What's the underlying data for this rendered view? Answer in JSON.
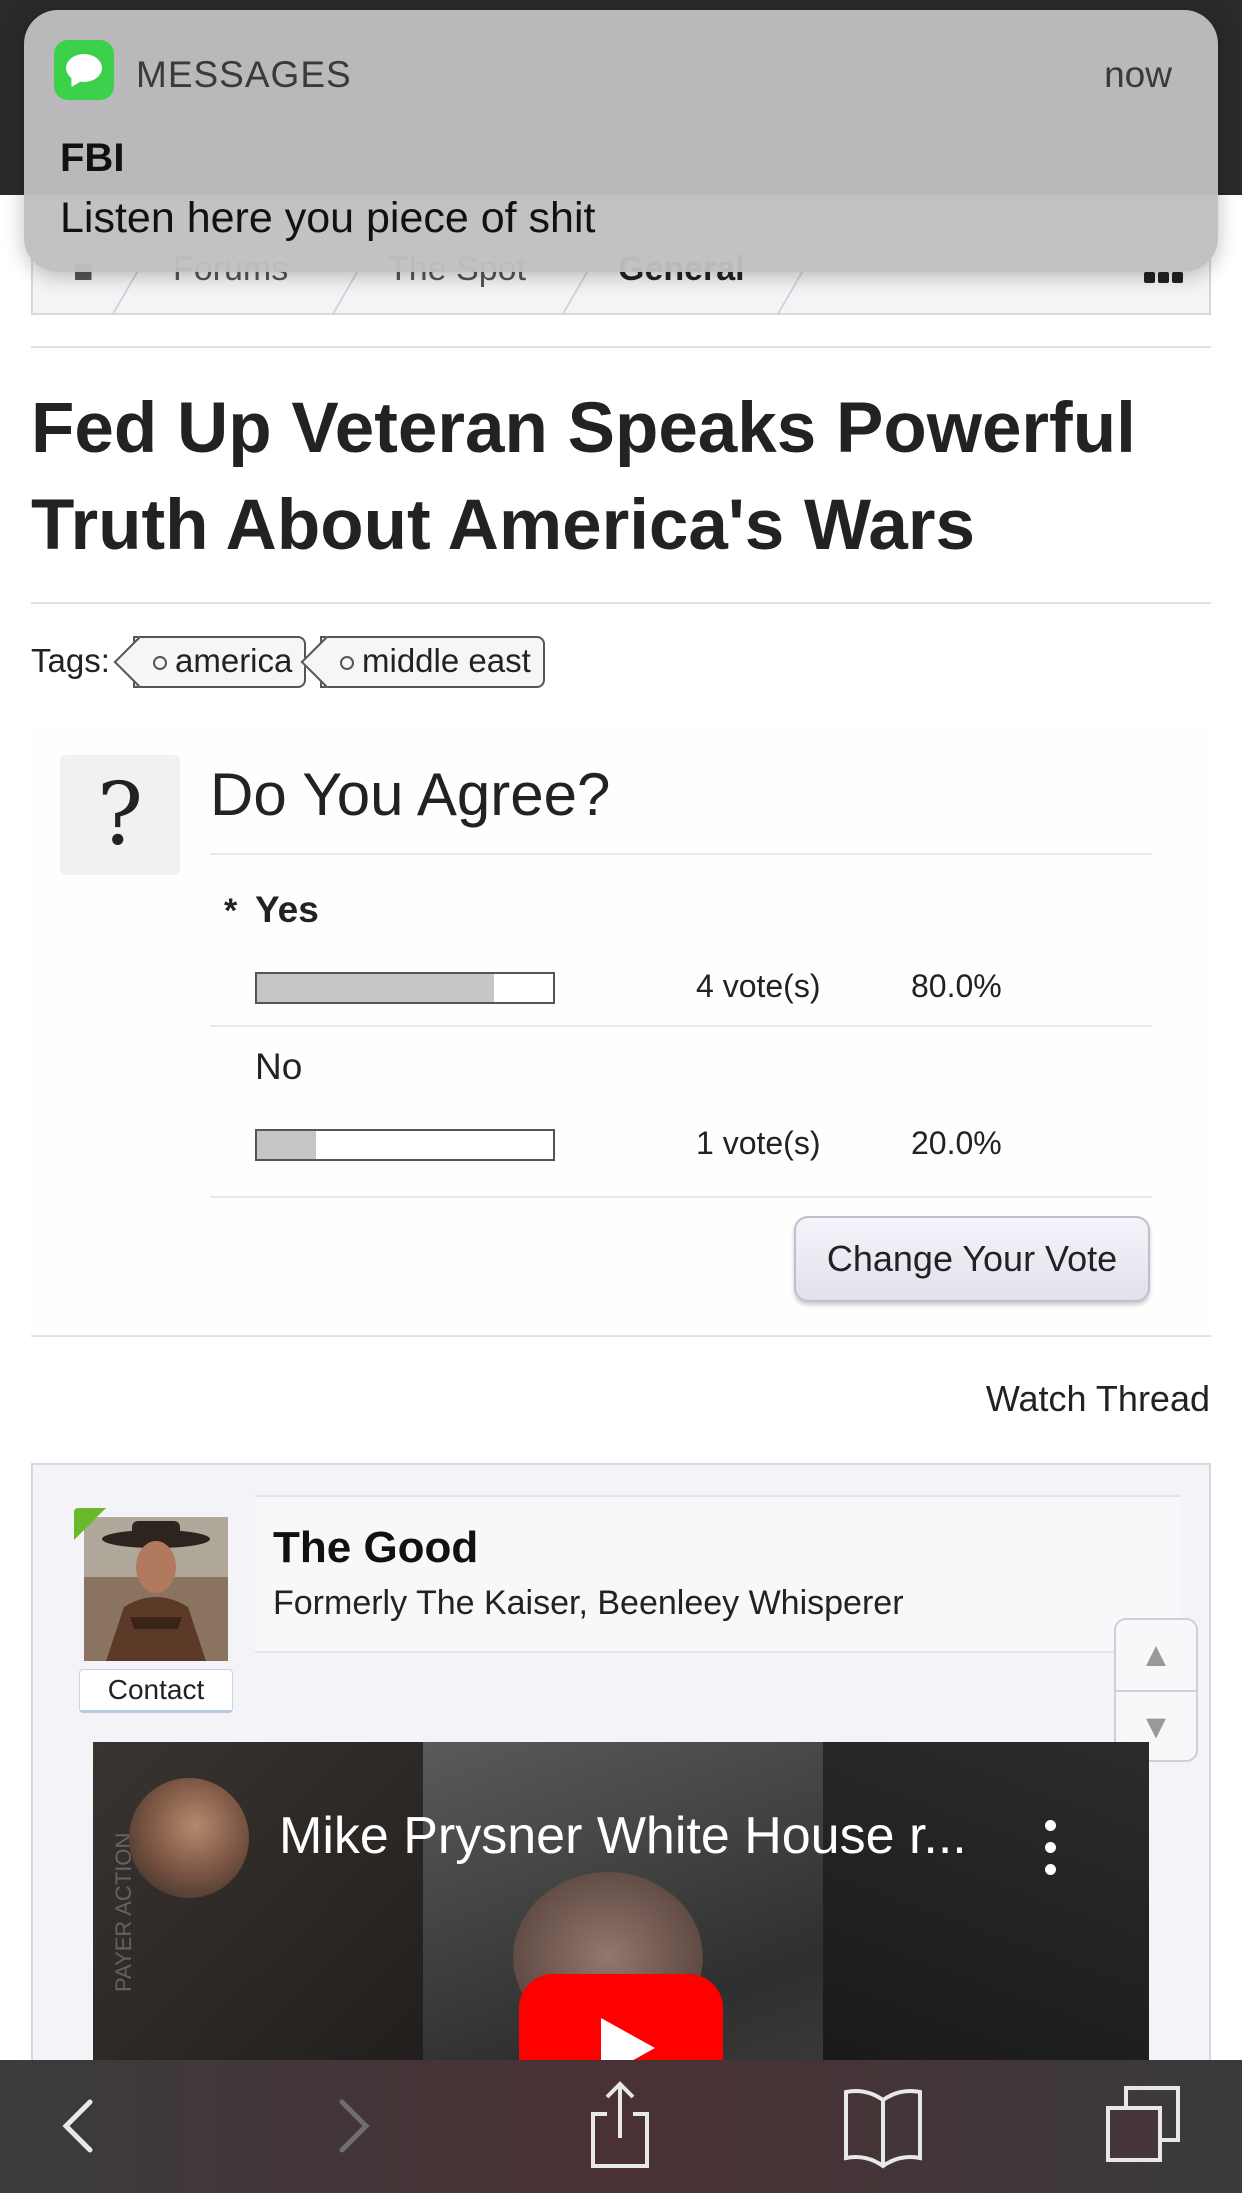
{
  "notification": {
    "app": "MESSAGES",
    "time": "now",
    "sender": "FBI",
    "message": "Listen here you piece of shit"
  },
  "breadcrumb": {
    "items": [
      "Forums",
      "The Spot",
      "General"
    ]
  },
  "thread": {
    "title": "Fed Up Veteran Speaks Powerful Truth About America's Wars",
    "tags_label": "Tags:",
    "tags": [
      "america",
      "middle east"
    ]
  },
  "poll": {
    "question": "Do You Agree?",
    "voted_marker": "*",
    "options": [
      {
        "label": "Yes",
        "votes": "4 vote(s)",
        "percent": "80.0%",
        "fraction": 0.8
      },
      {
        "label": "No",
        "votes": "1 vote(s)",
        "percent": "20.0%",
        "fraction": 0.2
      }
    ],
    "change_vote_label": "Change Your Vote"
  },
  "watch_thread_label": "Watch Thread",
  "post": {
    "username": "The Good",
    "user_title": "Formerly The Kaiser, Beenleey Whisperer",
    "contact_label": "Contact",
    "video": {
      "title": "Mike Prysner White House r...",
      "watermark": "PAYER ACTION"
    }
  },
  "icons": {
    "app_icon": "messages-icon",
    "back": "chevron-left-icon",
    "forward": "chevron-right-icon",
    "share": "share-icon",
    "bookmarks": "book-icon",
    "tabs": "tabs-icon"
  },
  "colors": {
    "messages_green": "#3bd14a",
    "online_green": "#6ab92c",
    "youtube_red": "#ff0000"
  }
}
